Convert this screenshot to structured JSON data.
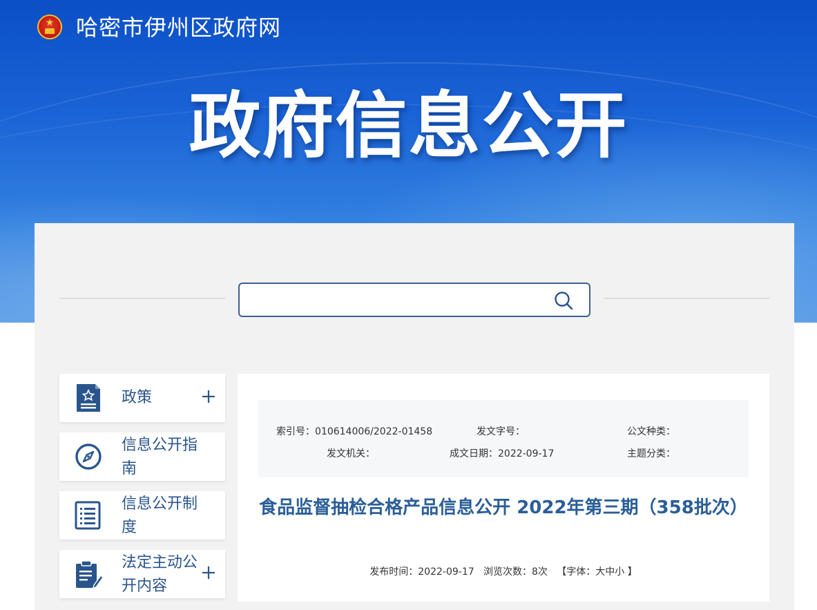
{
  "header": {
    "site_name": "哈密市伊州区政府网",
    "emblem_icon": "national-emblem-icon",
    "hero_title": "政府信息公开",
    "colors": {
      "banner_top": "#0b4fc6",
      "banner_bottom": "#5a9be6",
      "accent": "#2a558c"
    }
  },
  "search": {
    "value": "",
    "placeholder": "",
    "icon": "search-icon"
  },
  "sidebar": {
    "items": [
      {
        "label": "政策",
        "icon": "policy-document-icon",
        "expandable": true
      },
      {
        "label": "信息公开指南",
        "icon": "compass-icon",
        "expandable": false
      },
      {
        "label": "信息公开制度",
        "icon": "list-document-icon",
        "expandable": false
      },
      {
        "label": "法定主动公开内容",
        "icon": "clipboard-edit-icon",
        "expandable": true
      }
    ]
  },
  "meta": {
    "index_label": "索引号：",
    "index_value": "010614006/2022-01458",
    "doc_number_label": "发文字号：",
    "doc_number_value": "",
    "doc_type_label": "公文种类：",
    "doc_type_value": "",
    "issuer_label": "发文机关：",
    "issuer_value": "",
    "created_label": "成文日期：",
    "created_value": "2022-09-17",
    "topic_label": "主题分类：",
    "topic_value": ""
  },
  "article": {
    "title": "食品监督抽检合格产品信息公开 2022年第三期（358批次）",
    "publish_label": "发布时间：",
    "publish_value": "2022-09-17",
    "views_label": "浏览次数：",
    "views_value": "8次",
    "font_open": "【字体：",
    "font_large": "大",
    "font_medium": "中",
    "font_small": "小",
    "font_close": " 】"
  }
}
